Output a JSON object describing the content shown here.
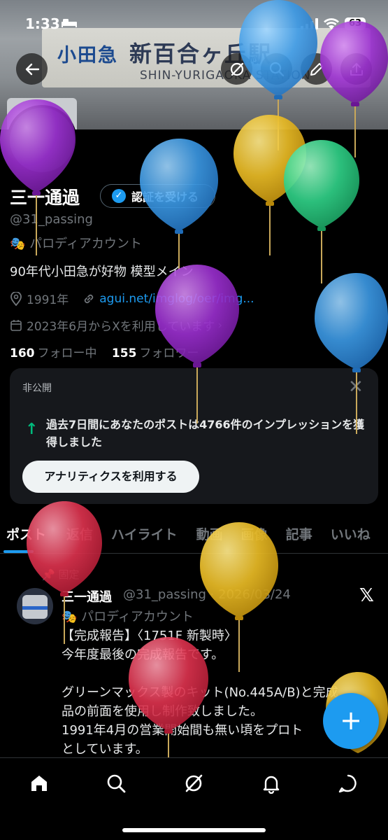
{
  "status_bar": {
    "time": "1:33",
    "battery": "63"
  },
  "banner": {
    "sign_brand": "小田急",
    "sign_station": "新百合ヶ丘駅",
    "sign_en": "SHIN-YURIGAOKA STATION"
  },
  "header": {
    "back_icon": "back-arrow-icon",
    "grok_icon": "grok-icon",
    "search_icon": "search-icon",
    "edit_icon": "pencil-icon",
    "share_icon": "share-icon"
  },
  "profile": {
    "name": "三一通過",
    "verify_label": "認証を受ける",
    "handle": "@31_passing",
    "parody_label": "パロディアカウント",
    "bio": "90年代小田急が好物 模型メイン",
    "location": "1991年",
    "link": "agui.net/imglog/oer/img...",
    "joined": "2023年6月からXを利用しています",
    "following_count": "160",
    "following_label": "フォロー中",
    "followers_count": "155",
    "followers_label": "フォロワー"
  },
  "analytics_card": {
    "private_label": "非公開",
    "message": "過去7日間にあなたのポストは4766件のインプレッションを獲得しました",
    "cta_label": "アナリティクスを利用する"
  },
  "tabs": [
    {
      "label": "ポスト",
      "active": true
    },
    {
      "label": "返信",
      "active": false
    },
    {
      "label": "ハイライト",
      "active": false
    },
    {
      "label": "動画",
      "active": false
    },
    {
      "label": "画像",
      "active": false
    },
    {
      "label": "記事",
      "active": false
    },
    {
      "label": "いいね",
      "active": false
    }
  ],
  "post": {
    "pinned_label": "固定",
    "author_name": "三一通過",
    "author_meta": "@31_passing · 2026/03/24",
    "parody_label": "パロディアカウント",
    "lines": [
      "【完成報告】〈1751F 新製時〉",
      "今年度最後の完成報告です。",
      "",
      "グリーンマックス製のキット(No.445A/B)と完成",
      "品の前面を使用し制作致しました。",
      "1991年4月の営業開始間も無い頃をプロト",
      "としています。"
    ]
  },
  "fab_label": "+",
  "bottom_nav": [
    "home-icon",
    "search-icon",
    "grok-icon",
    "notifications-icon",
    "messages-icon"
  ],
  "colors": {
    "accent": "#1d9bf0",
    "background": "#000000",
    "secondary_text": "#71767b",
    "impression_arrow": "#00ba7c"
  }
}
